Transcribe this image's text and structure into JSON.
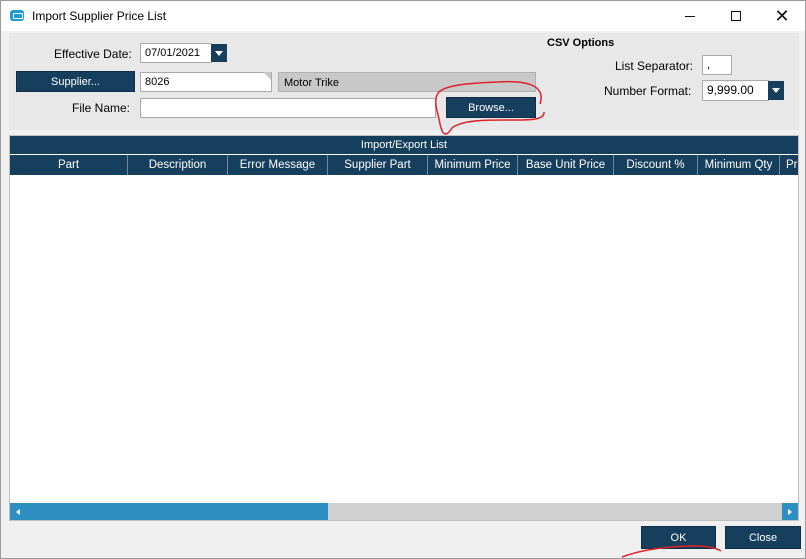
{
  "window": {
    "title": "Import Supplier Price List",
    "controls": {
      "minimize": "—",
      "maximize": "☐",
      "close": "✕"
    }
  },
  "form": {
    "effective_date_label": "Effective Date:",
    "effective_date_value": "07/01/2021",
    "supplier_button": "Supplier...",
    "supplier_code": "8026",
    "supplier_name": "Motor Trike",
    "file_name_label": "File Name:",
    "file_name_value": "",
    "browse_button": "Browse..."
  },
  "csv_options": {
    "title": "CSV Options",
    "list_separator_label": "List Separator:",
    "list_separator_value": ",",
    "number_format_label": "Number Format:",
    "number_format_value": "9,999.00"
  },
  "grid": {
    "caption": "Import/Export List",
    "columns": [
      "Part",
      "Description",
      "Error Message",
      "Supplier Part",
      "Minimum Price",
      "Base Unit Price",
      "Discount %",
      "Minimum Qty",
      "Pri"
    ],
    "rows": []
  },
  "footer": {
    "ok_button": "OK",
    "close_button": "Close"
  },
  "colors": {
    "accent_dark": "#163f5e",
    "scroll_blue": "#2c8fc0",
    "annotation_red": "#e0202a"
  },
  "icons": {
    "app": "app-window-icon",
    "dropdown": "chevron-down-icon"
  }
}
